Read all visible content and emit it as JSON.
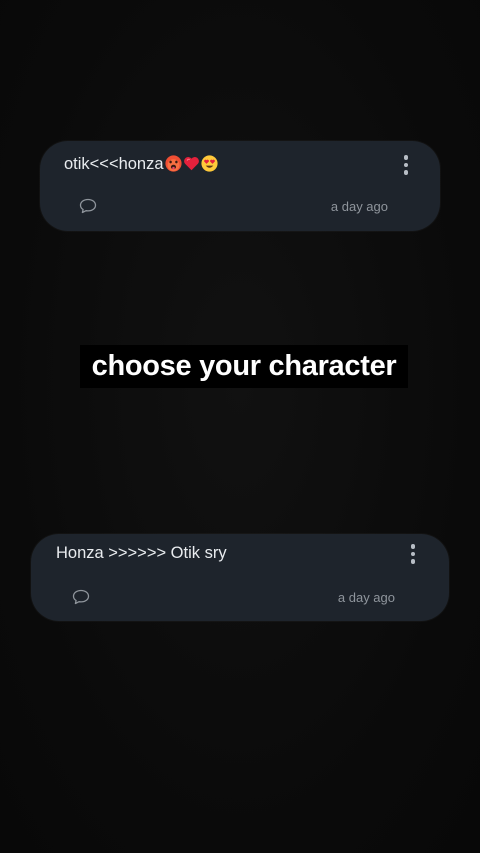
{
  "comments": [
    {
      "text": "otik<<<honza",
      "emojis": [
        "hot-face-emoji",
        "red-heart-emoji",
        "heart-eyes-emoji"
      ],
      "timestamp": "a day ago"
    },
    {
      "text": "Honza >>>>>> Otik sry",
      "emojis": [],
      "timestamp": "a day ago"
    }
  ],
  "caption": "choose your character",
  "colors": {
    "background": "#0c0c0c",
    "card": "#1e242c",
    "text": "#e9ecef",
    "muted": "#8f959c",
    "caption_bg": "#000000",
    "caption_text": "#ffffff"
  },
  "icons": {
    "menu": "more-vertical-icon",
    "reply": "speech-bubble-icon"
  }
}
